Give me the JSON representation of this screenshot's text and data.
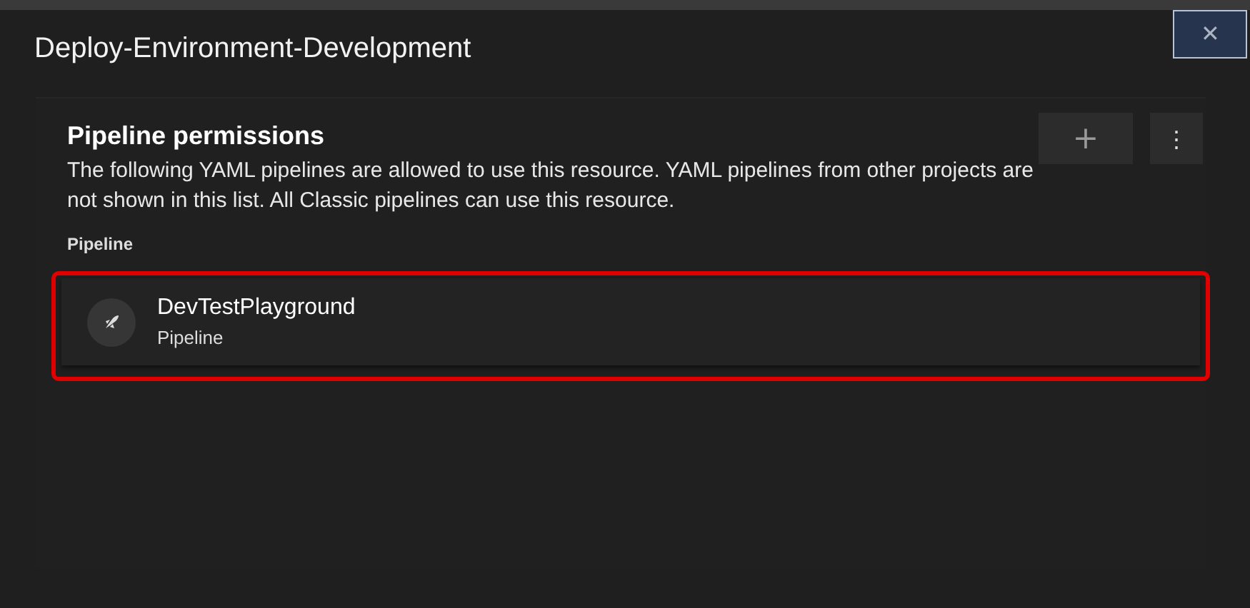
{
  "dialog": {
    "title": "Deploy-Environment-Development",
    "close_icon": "✕"
  },
  "section": {
    "heading": "Pipeline permissions",
    "description": "The following YAML pipelines are allowed to use this resource. YAML pipelines from other projects are not shown in this list. All Classic pipelines can use this resource.",
    "add_button": "+",
    "more_button": "⋮",
    "column_header": "Pipeline"
  },
  "pipelines": [
    {
      "name": "DevTestPlayground",
      "type": "Pipeline",
      "highlighted": true
    }
  ]
}
